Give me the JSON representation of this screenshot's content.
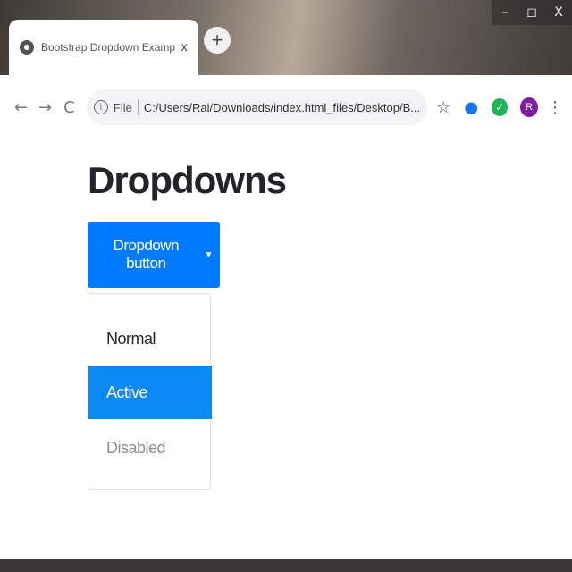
{
  "window": {
    "minimize_glyph": "–",
    "maximize_glyph": "◻",
    "close_glyph": "X"
  },
  "tab": {
    "title": "Bootstrap Dropdown Example",
    "close_glyph": "x",
    "favicon": "globe-icon"
  },
  "newtab": {
    "glyph": "+"
  },
  "toolbar": {
    "back_glyph": "←",
    "forward_glyph": "→",
    "reload_glyph": "C",
    "info_glyph": "i",
    "scheme": "File",
    "url": "C:/Users/Rai/Downloads/index.html_files/Desktop/B...",
    "star_glyph": "☆",
    "profile_initial": "R",
    "menu_glyph": "⋮"
  },
  "page": {
    "title": "Dropdowns",
    "dropdown_button_label": "Dropdown button",
    "caret_glyph": "▼",
    "items": [
      {
        "label": "Normal",
        "state": "normal"
      },
      {
        "label": "Active",
        "state": "active"
      },
      {
        "label": "Disabled",
        "state": "disabled"
      }
    ]
  },
  "colors": {
    "primary": "#007bff",
    "active_item": "#0b8af5",
    "profile": "#7b1fa2",
    "extension_green": "#1fb455"
  }
}
